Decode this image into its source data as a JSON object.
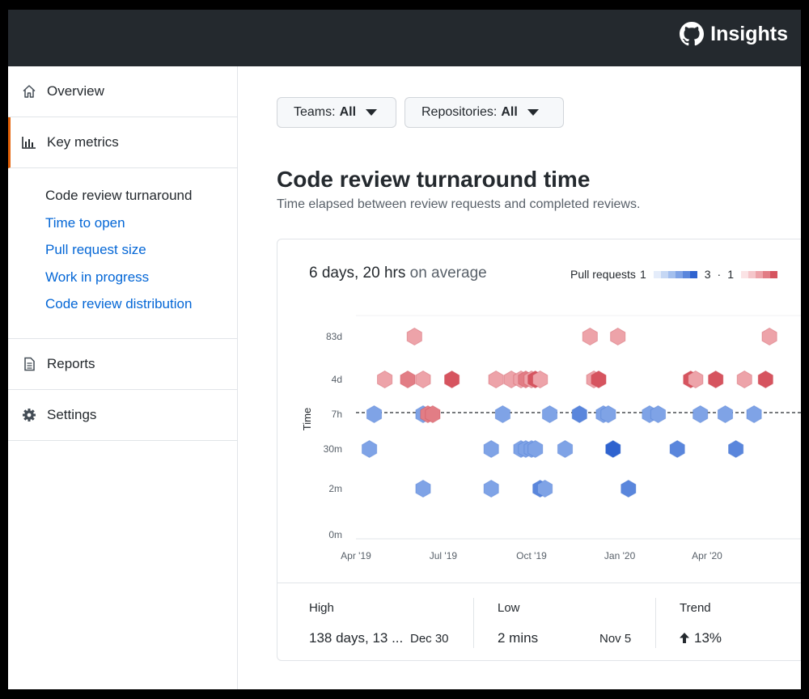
{
  "header": {
    "title": "Insights",
    "logo_icon": "github-octocat-icon"
  },
  "sidebar": {
    "items": [
      {
        "label": "Overview",
        "icon": "home-icon"
      },
      {
        "label": "Key metrics",
        "icon": "bar-chart-icon",
        "active": true
      },
      {
        "label": "Reports",
        "icon": "file-icon"
      },
      {
        "label": "Settings",
        "icon": "gear-icon"
      }
    ],
    "subitems": [
      {
        "label": "Code review turnaround",
        "current": true
      },
      {
        "label": "Time to open"
      },
      {
        "label": "Pull request size"
      },
      {
        "label": "Work in progress"
      },
      {
        "label": "Code review distribution"
      }
    ]
  },
  "filters": {
    "teams_label": "Teams:",
    "teams_value": "All",
    "repos_label": "Repositories:",
    "repos_value": "All"
  },
  "page": {
    "title": "Code review turnaround time",
    "subtitle": "Time elapsed between review requests and completed reviews."
  },
  "summary": {
    "value": "6 days, 20 hrs",
    "suffix": "on average"
  },
  "legend": {
    "label": "Pull requests",
    "min": "1",
    "max": "3",
    "sep": "·",
    "min2": "1",
    "blue_scale": [
      "#e4ecfa",
      "#c5d7f4",
      "#a3bfee",
      "#7fa3e6",
      "#5a86dc",
      "#2f63cf"
    ],
    "red_scale": [
      "#fbe3e5",
      "#f5c6ca",
      "#eda3a9",
      "#e27d85",
      "#d6545f"
    ]
  },
  "chart_data": {
    "type": "scatter",
    "marker": "hexagon",
    "xlabel": "",
    "ylabel": "Time",
    "x_tick_labels": [
      "Apr '19",
      "Jul '19",
      "Oct '19",
      "Jan '20",
      "Apr '20"
    ],
    "y_tick_labels": [
      "0m",
      "2m",
      "30m",
      "7h",
      "4d",
      "83d"
    ],
    "ylim_labels": [
      "0m",
      "83d"
    ],
    "scale": "log",
    "reference_line": "average",
    "colors": {
      "above_average": "#d6545f",
      "below_average": "#5a86dc"
    },
    "points": [
      {
        "x": "2019-04-15",
        "y": "30m",
        "count": 1
      },
      {
        "x": "2019-04-20",
        "y": "7h",
        "count": 1
      },
      {
        "x": "2019-05-01",
        "y": "4d",
        "count": 1
      },
      {
        "x": "2019-06-01",
        "y": "83d",
        "count": 1
      },
      {
        "x": "2019-05-25",
        "y": "4d",
        "count": 2
      },
      {
        "x": "2019-06-10",
        "y": "4d",
        "count": 1
      },
      {
        "x": "2019-06-10",
        "y": "7h",
        "count": 1
      },
      {
        "x": "2019-06-15",
        "y": "7h",
        "count": 2
      },
      {
        "x": "2019-06-20",
        "y": "7h",
        "count": 2
      },
      {
        "x": "2019-06-10",
        "y": "2m",
        "count": 1
      },
      {
        "x": "2019-07-10",
        "y": "4d",
        "count": 3
      },
      {
        "x": "2019-08-20",
        "y": "30m",
        "count": 1
      },
      {
        "x": "2019-08-20",
        "y": "2m",
        "count": 1
      },
      {
        "x": "2019-08-25",
        "y": "4d",
        "count": 1
      },
      {
        "x": "2019-09-01",
        "y": "7h",
        "count": 1
      },
      {
        "x": "2019-09-10",
        "y": "4d",
        "count": 1
      },
      {
        "x": "2019-09-20",
        "y": "4d",
        "count": 1
      },
      {
        "x": "2019-09-25",
        "y": "4d",
        "count": 2
      },
      {
        "x": "2019-10-01",
        "y": "4d",
        "count": 1
      },
      {
        "x": "2019-10-05",
        "y": "4d",
        "count": 3
      },
      {
        "x": "2019-10-10",
        "y": "4d",
        "count": 1
      },
      {
        "x": "2019-09-20",
        "y": "30m",
        "count": 1
      },
      {
        "x": "2019-09-25",
        "y": "30m",
        "count": 1
      },
      {
        "x": "2019-10-01",
        "y": "30m",
        "count": 1
      },
      {
        "x": "2019-10-05",
        "y": "30m",
        "count": 1
      },
      {
        "x": "2019-10-10",
        "y": "2m",
        "count": 2
      },
      {
        "x": "2019-10-15",
        "y": "2m",
        "count": 1
      },
      {
        "x": "2019-10-20",
        "y": "7h",
        "count": 1
      },
      {
        "x": "2019-11-05",
        "y": "30m",
        "count": 1
      },
      {
        "x": "2019-11-20",
        "y": "7h",
        "count": 2
      },
      {
        "x": "2019-12-01",
        "y": "83d",
        "count": 1
      },
      {
        "x": "2019-12-05",
        "y": "4d",
        "count": 1
      },
      {
        "x": "2019-12-10",
        "y": "4d",
        "count": 3
      },
      {
        "x": "2019-12-15",
        "y": "7h",
        "count": 1
      },
      {
        "x": "2019-12-20",
        "y": "7h",
        "count": 1
      },
      {
        "x": "2019-12-25",
        "y": "30m",
        "count": 3
      },
      {
        "x": "2019-12-30",
        "y": "83d",
        "count": 1
      },
      {
        "x": "2020-01-10",
        "y": "2m",
        "count": 2
      },
      {
        "x": "2020-02-01",
        "y": "7h",
        "count": 1
      },
      {
        "x": "2020-02-10",
        "y": "7h",
        "count": 1
      },
      {
        "x": "2020-03-01",
        "y": "30m",
        "count": 2
      },
      {
        "x": "2020-03-15",
        "y": "4d",
        "count": 3
      },
      {
        "x": "2020-03-20",
        "y": "4d",
        "count": 1
      },
      {
        "x": "2020-03-25",
        "y": "7h",
        "count": 1
      },
      {
        "x": "2020-04-10",
        "y": "4d",
        "count": 3
      },
      {
        "x": "2020-04-20",
        "y": "7h",
        "count": 1
      },
      {
        "x": "2020-05-01",
        "y": "30m",
        "count": 2
      },
      {
        "x": "2020-05-10",
        "y": "4d",
        "count": 1
      },
      {
        "x": "2020-05-20",
        "y": "7h",
        "count": 1
      },
      {
        "x": "2020-06-01",
        "y": "4d",
        "count": 3
      },
      {
        "x": "2020-06-05",
        "y": "83d",
        "count": 1
      }
    ]
  },
  "stats": [
    {
      "label": "High",
      "value": "138 days, 13 ...",
      "date": "Dec 30"
    },
    {
      "label": "Low",
      "value": "2 mins",
      "date": "Nov 5"
    },
    {
      "label": "Trend",
      "value": "13%",
      "direction": "up",
      "icon": "arrow-up-icon"
    }
  ]
}
